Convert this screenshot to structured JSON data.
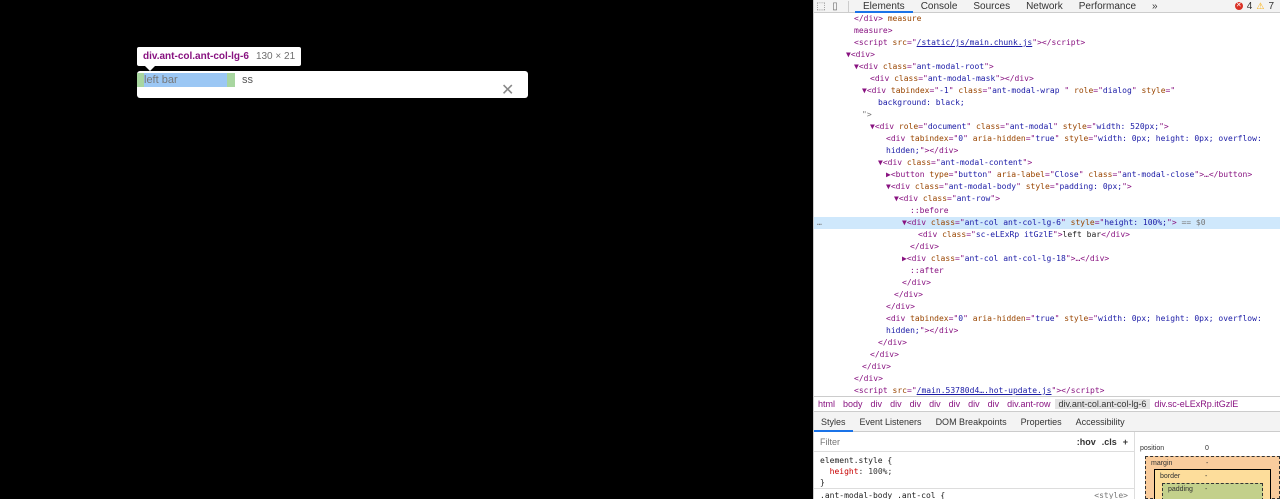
{
  "page": {
    "tooltip": {
      "selector": "div.ant-col.ant-col-lg-6",
      "size": "130 × 21"
    },
    "modal": {
      "left_text": "left bar",
      "right_text": "ss",
      "close": "✕"
    }
  },
  "devtools": {
    "tabs": [
      "Elements",
      "Console",
      "Sources",
      "Network",
      "Performance"
    ],
    "more": "»",
    "errors": "4",
    "warnings": "7",
    "warning_icon": "⚠",
    "dom_lines": [
      {
        "indent": 4,
        "html": "<span class='t-tag'>&lt;/div&gt;</span><span class='t-attr'> measure</span>"
      },
      {
        "indent": 4,
        "html": "<span class='t-tag'>measure&gt;</span>"
      },
      {
        "indent": 4,
        "html": "<span class='t-tag'>&lt;script</span> <span class='t-attr'>src</span>=\"<span class='t-link'>/static/js/main.chunk.js</span>\"<span class='t-tag'>&gt;&lt;/script&gt;</span>"
      },
      {
        "indent": 3,
        "html": "▼<span class='t-tag'>&lt;div&gt;</span>"
      },
      {
        "indent": 4,
        "html": "▼<span class='t-tag'>&lt;div</span> <span class='t-attr'>class</span>=\"<span class='t-val'>ant-modal-root</span>\"<span class='t-tag'>&gt;</span>"
      },
      {
        "indent": 6,
        "html": "<span class='t-tag'>&lt;div</span> <span class='t-attr'>class</span>=\"<span class='t-val'>ant-modal-mask</span>\"<span class='t-tag'>&gt;&lt;/div&gt;</span>"
      },
      {
        "indent": 5,
        "html": "▼<span class='t-tag'>&lt;div</span> <span class='t-attr'>tabindex</span>=\"<span class='t-val'>-1</span>\" <span class='t-attr'>class</span>=\"<span class='t-val'>ant-modal-wrap </span>\" <span class='t-attr'>role</span>=\"<span class='t-val'>dialog</span>\" <span class='t-attr'>style</span>=\""
      },
      {
        "indent": 7,
        "html": "<span class='t-val'>background: black;</span>"
      },
      {
        "indent": 5,
        "html": "<span class='t-dim'>\"&gt;</span>"
      },
      {
        "indent": 6,
        "html": "▼<span class='t-tag'>&lt;div</span> <span class='t-attr'>role</span>=\"<span class='t-val'>document</span>\" <span class='t-attr'>class</span>=\"<span class='t-val'>ant-modal</span>\" <span class='t-attr'>style</span>=\"<span class='t-val'>width: 520px;</span>\"<span class='t-tag'>&gt;</span>"
      },
      {
        "indent": 8,
        "html": "<span class='t-tag'>&lt;div</span> <span class='t-attr'>tabindex</span>=\"<span class='t-val'>0</span>\" <span class='t-attr'>aria-hidden</span>=\"<span class='t-val'>true</span>\" <span class='t-attr'>style</span>=\"<span class='t-val'>width: 0px; height: 0px; overflow:</span>"
      },
      {
        "indent": 8,
        "html": "<span class='t-val'>hidden;</span>\"<span class='t-tag'>&gt;&lt;/div&gt;</span>"
      },
      {
        "indent": 7,
        "html": "▼<span class='t-tag'>&lt;div</span> <span class='t-attr'>class</span>=\"<span class='t-val'>ant-modal-content</span>\"<span class='t-tag'>&gt;</span>"
      },
      {
        "indent": 8,
        "html": "▶<span class='t-tag'>&lt;button</span> <span class='t-attr'>type</span>=\"<span class='t-val'>button</span>\" <span class='t-attr'>aria-label</span>=\"<span class='t-val'>Close</span>\" <span class='t-attr'>class</span>=\"<span class='t-val'>ant-modal-close</span>\"<span class='t-tag'>&gt;</span>…<span class='t-tag'>&lt;/button&gt;</span>"
      },
      {
        "indent": 8,
        "html": "▼<span class='t-tag'>&lt;div</span> <span class='t-attr'>class</span>=\"<span class='t-val'>ant-modal-body</span>\" <span class='t-attr'>style</span>=\"<span class='t-val'>padding: 0px;</span>\"<span class='t-tag'>&gt;</span>"
      },
      {
        "indent": 9,
        "html": "▼<span class='t-tag'>&lt;div</span> <span class='t-attr'>class</span>=\"<span class='t-val'>ant-row</span>\"<span class='t-tag'>&gt;</span>"
      },
      {
        "indent": 11,
        "html": "<span class='t-pseudo'>::before</span>"
      },
      {
        "indent": 10,
        "html": "▼<span class='t-tag'>&lt;div</span> <span class='t-attr'>class</span>=\"<span class='t-val'>ant-col ant-col-lg-6</span>\" <span class='t-attr'>style</span>=\"<span class='t-val'>height: 100%;</span>\"<span class='t-tag'>&gt;</span> <span class='t-dim'>== $0</span>",
        "selected": true
      },
      {
        "indent": 12,
        "html": "<span class='t-tag'>&lt;div</span> <span class='t-attr'>class</span>=\"<span class='t-val'>sc-eLExRp itGzlE</span>\"<span class='t-tag'>&gt;</span><span class='t-text'>left bar</span><span class='t-tag'>&lt;/div&gt;</span>"
      },
      {
        "indent": 11,
        "html": "<span class='t-tag'>&lt;/div&gt;</span>"
      },
      {
        "indent": 10,
        "html": "▶<span class='t-tag'>&lt;div</span> <span class='t-attr'>class</span>=\"<span class='t-val'>ant-col ant-col-lg-18</span>\"<span class='t-tag'>&gt;</span>…<span class='t-tag'>&lt;/div&gt;</span>"
      },
      {
        "indent": 11,
        "html": "<span class='t-pseudo'>::after</span>"
      },
      {
        "indent": 10,
        "html": "<span class='t-tag'>&lt;/div&gt;</span>"
      },
      {
        "indent": 9,
        "html": "<span class='t-tag'>&lt;/div&gt;</span>"
      },
      {
        "indent": 8,
        "html": "<span class='t-tag'>&lt;/div&gt;</span>"
      },
      {
        "indent": 8,
        "html": "<span class='t-tag'>&lt;div</span> <span class='t-attr'>tabindex</span>=\"<span class='t-val'>0</span>\" <span class='t-attr'>aria-hidden</span>=\"<span class='t-val'>true</span>\" <span class='t-attr'>style</span>=\"<span class='t-val'>width: 0px; height: 0px; overflow:</span>"
      },
      {
        "indent": 8,
        "html": "<span class='t-val'>hidden;</span>\"<span class='t-tag'>&gt;&lt;/div&gt;</span>"
      },
      {
        "indent": 7,
        "html": "<span class='t-tag'>&lt;/div&gt;</span>"
      },
      {
        "indent": 6,
        "html": "<span class='t-tag'>&lt;/div&gt;</span>"
      },
      {
        "indent": 5,
        "html": "<span class='t-tag'>&lt;/div&gt;</span>"
      },
      {
        "indent": 4,
        "html": "<span class='t-tag'>&lt;/div&gt;</span>"
      },
      {
        "indent": 4,
        "html": "<span class='t-tag'>&lt;script</span> <span class='t-attr'>src</span>=\"<span class='t-link'>/main.53780d4….hot-update.js</span>\"<span class='t-tag'>&gt;&lt;/script&gt;</span>"
      }
    ],
    "breadcrumbs": [
      "html",
      "body",
      "div",
      "div",
      "div",
      "div",
      "div",
      "div",
      "div",
      "div.ant-row",
      "div.ant-col.ant-col-lg-6",
      "div.sc-eLExRp.itGzlE"
    ],
    "active_crumb": 10,
    "subtabs": [
      "Styles",
      "Event Listeners",
      "DOM Breakpoints",
      "Properties",
      "Accessibility"
    ],
    "filter_placeholder": "Filter",
    "hov": ":hov",
    "cls": ".cls",
    "plus": "+",
    "element_style_selector": "element.style {",
    "element_style_prop": "height",
    "element_style_value": "100%;",
    "element_style_close": "}",
    "next_rule": ".ant-modal-body .ant-col {",
    "next_rule_src": "<style>",
    "box": {
      "position_label": "position",
      "position_val": "0",
      "margin_label": "margin",
      "margin_val": "-",
      "border_label": "border",
      "border_val": "-",
      "padding_label": "padding",
      "padding_val": "-"
    }
  }
}
